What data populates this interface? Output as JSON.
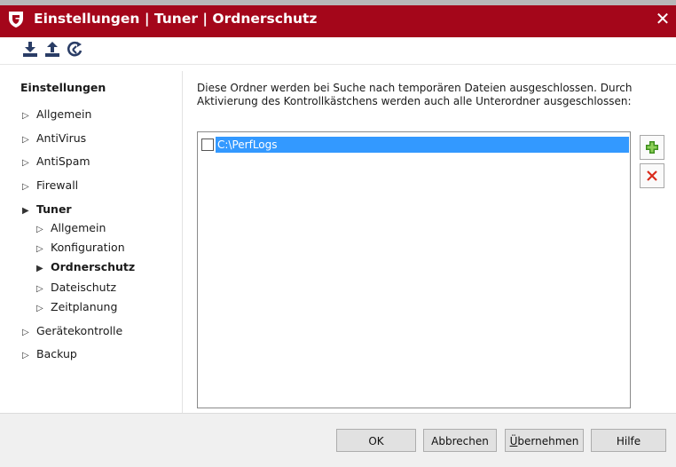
{
  "window": {
    "title": "Einstellungen | Tuner | Ordnerschutz",
    "close_symbol": "✕",
    "titlebar_color": "#a4061a"
  },
  "toolbar": {
    "buttons": [
      {
        "icon": "download-icon"
      },
      {
        "icon": "upload-icon"
      },
      {
        "icon": "reset-defaults-icon"
      }
    ]
  },
  "sidebar": {
    "heading": "Einstellungen",
    "items": [
      {
        "label": "Allgemein"
      },
      {
        "label": "AntiVirus"
      },
      {
        "label": "AntiSpam"
      },
      {
        "label": "Firewall"
      },
      {
        "label": "Tuner",
        "expanded": true
      },
      {
        "label": "Allgemein"
      },
      {
        "label": "Konfiguration"
      },
      {
        "label": "Ordnerschutz",
        "selected": true
      },
      {
        "label": "Dateischutz"
      },
      {
        "label": "Zeitplanung"
      },
      {
        "label": "Gerätekontrolle"
      },
      {
        "label": "Backup"
      }
    ]
  },
  "main": {
    "description": "Diese Ordner werden bei Suche nach temporären Dateien ausgeschlossen. Durch Aktivierung des Kontrollkästchens werden auch alle Unterordner ausgeschlossen:",
    "folders": [
      {
        "path": "C:\\PerfLogs",
        "checked": false,
        "selected": true
      }
    ],
    "add_icon": "add-icon",
    "remove_icon": "remove-icon"
  },
  "footer": {
    "ok": "OK",
    "cancel": "Abbrechen",
    "apply_prefix": "Ü",
    "apply_rest": "bernehmen",
    "help": "Hilfe"
  }
}
